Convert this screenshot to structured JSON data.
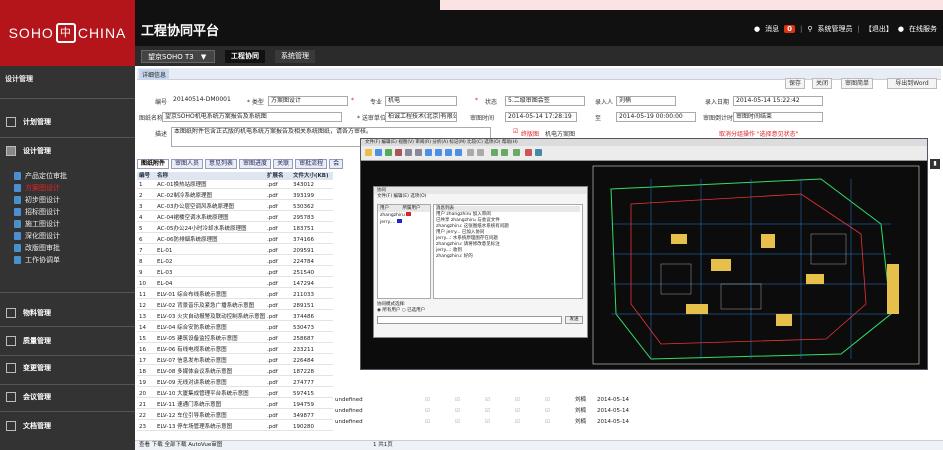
{
  "brand": {
    "left": "SOHO",
    "mark": "中",
    "right": "CHINA"
  },
  "header": {
    "title": "工程协同平台",
    "msg_label": "消息",
    "msg_count": "0",
    "user": "系统管理员",
    "logout": "【退出】",
    "online": "在线服务"
  },
  "subbar": {
    "project": "望京SOHO T3",
    "arrow": "▼",
    "tab1": "工程协同",
    "tab2": "系统管理"
  },
  "sidebar": {
    "heading": "设计管理",
    "groups": [
      {
        "label": "计划管理"
      },
      {
        "label": "设计管理"
      },
      {
        "label": "物料管理"
      },
      {
        "label": "质量管理"
      },
      {
        "label": "变更管理"
      },
      {
        "label": "会议管理"
      },
      {
        "label": "文档管理"
      }
    ],
    "items": [
      {
        "label": "产品定位审批"
      },
      {
        "label": "方案图设计",
        "active": true
      },
      {
        "label": "初步图设计"
      },
      {
        "label": "招标图设计"
      },
      {
        "label": "施工图设计"
      },
      {
        "label": "深化图设计"
      },
      {
        "label": "改版图审批"
      },
      {
        "label": "工作协调单"
      }
    ]
  },
  "detail_tab": "详细信息",
  "actions": {
    "save": "保存",
    "close": "关闭",
    "review": "审图简单",
    "export": "导出到Word"
  },
  "form": {
    "code_label": "编号",
    "code": "20140514-DM0001",
    "type_label": "* 类型",
    "type": "方案图设计",
    "major_label": "专业",
    "major": "机电",
    "status_label": "状态",
    "status": "5.二级审图会签",
    "entry_label": "录入人",
    "entry": "刘楠",
    "date_label": "录入日期",
    "date": "2014-05-14 15:22:42",
    "name_label": "图纸名称",
    "name": "望京SOHO机电系统方案报告及系统图",
    "send_label": "* 送审单位",
    "send": "柏诚工程技术(北京)有限公司",
    "time_label": "审图时间",
    "time_from": "2014-05-14 17:28:19",
    "to": "至",
    "time_to": "2014-05-19 00:00:00",
    "sched_label": "审图倒计时",
    "sched": "审图时间结束",
    "desc_label": "描述",
    "desc": "本图纸附件包含正式版的机电系统方案报告及相关系统图纸，请各方审核。",
    "check_a": "终版图",
    "check_b": "机电方案图",
    "cancel_note": "取消分组操作 \"选择意见状态\""
  },
  "tabs": [
    "图纸附件",
    "审图人员",
    "意见列表",
    "审图进度",
    "关联",
    "审批流程",
    "会"
  ],
  "table": {
    "headers": [
      "编号",
      "名称",
      "扩展名",
      "文件大小(KB)"
    ],
    "rows": [
      [
        "1",
        "AC-01换热站原理图",
        ".pdf",
        "343012"
      ],
      [
        "2",
        "AC-02制冷系统原理图",
        ".pdf",
        "393199"
      ],
      [
        "3",
        "AC-03办公层空调风系统原理图",
        ".pdf",
        "530362"
      ],
      [
        "4",
        "AC-04裙楼空调水系统原理图",
        ".pdf",
        "295783"
      ],
      [
        "5",
        "AC-05办公24小时冷却水系统原理图",
        ".pdf",
        "183751"
      ],
      [
        "6",
        "AC-06防排烟系统原理图",
        ".pdf",
        "374166"
      ],
      [
        "7",
        "EL-01",
        ".pdf",
        "209591"
      ],
      [
        "8",
        "EL-02",
        ".pdf",
        "224784"
      ],
      [
        "9",
        "EL-03",
        ".pdf",
        "251540"
      ],
      [
        "10",
        "EL-04",
        ".pdf",
        "147294"
      ],
      [
        "11",
        "ELV-01 综合布线系统示意图",
        ".pdf",
        "211033"
      ],
      [
        "12",
        "ELV-02 背景音乐及紧急广播系统示意图",
        ".pdf",
        "289151"
      ],
      [
        "13",
        "ELV-03 火灾自动报警及联动控制系统示意图",
        ".pdf",
        "374486"
      ],
      [
        "14",
        "ELV-04 综合安防系统示意图",
        ".pdf",
        "530473"
      ],
      [
        "15",
        "ELV-05 建筑设备监控系统示意图",
        ".pdf",
        "258687"
      ],
      [
        "16",
        "ELV-06 有线电视系统示意图",
        ".pdf",
        "233211"
      ],
      [
        "17",
        "ELV-07 信息发布系统示意图",
        ".pdf",
        "226484"
      ],
      [
        "18",
        "ELV-08 多媒体会议系统示意图",
        ".pdf",
        "187228"
      ],
      [
        "19",
        "ELV-09 无线对讲系统示意图",
        ".pdf",
        "274777"
      ],
      [
        "20",
        "ELV-10 大厦集成管理平台系统示意图",
        ".pdf",
        "597415"
      ],
      [
        "21",
        "ELV-11 速通门系统示意图",
        ".pdf",
        "194759"
      ],
      [
        "22",
        "ELV-12 车位引导系统示意图",
        ".pdf",
        "349877"
      ],
      [
        "23",
        "ELV-13 停车场管理系统示意图",
        ".pdf",
        "190280"
      ]
    ]
  },
  "ghost_rows": [
    [
      "undefined",
      "刘楠",
      "2014-05-14"
    ],
    [
      "undefined",
      "刘楠",
      "2014-05-14"
    ],
    [
      "undefined",
      "刘楠",
      "2014-05-14"
    ]
  ],
  "pager": {
    "left": "查看  下载  全部下载  AutoVue审图",
    "page": "1 共1页"
  },
  "viewer": {
    "menu": "文件(F)  编辑(E)  视图(V)  审阅(R)  分析(A)  标记(M)  比较(C)  选项(O)  帮助(H)"
  },
  "chat": {
    "title": "协同",
    "menu": "文件(F)  编辑(E)  选项(O)",
    "user_hdr": "用户",
    "user_hdr2": "所属用户",
    "users": [
      "zhangzhiru",
      "jerry...."
    ],
    "msgs_hdr": "消息列表",
    "msgs": [
      "用户 zhangzhiru 加入审阅",
      "已共享 zhangzhiru 与会议文件",
      "zhangzhiru: 这张图纸水系统有问题",
      "用户 jerry... 已加入协同",
      "jerry...: 水系统原理图存在问题",
      "zhangzhiru: 请将修改意见标注",
      "jerry...: 收到",
      "zhangzhiru: 好的"
    ],
    "rights_label": "协同模式选择:",
    "opt1": "所有用户",
    "opt2": "已选用户",
    "send": "发送"
  }
}
